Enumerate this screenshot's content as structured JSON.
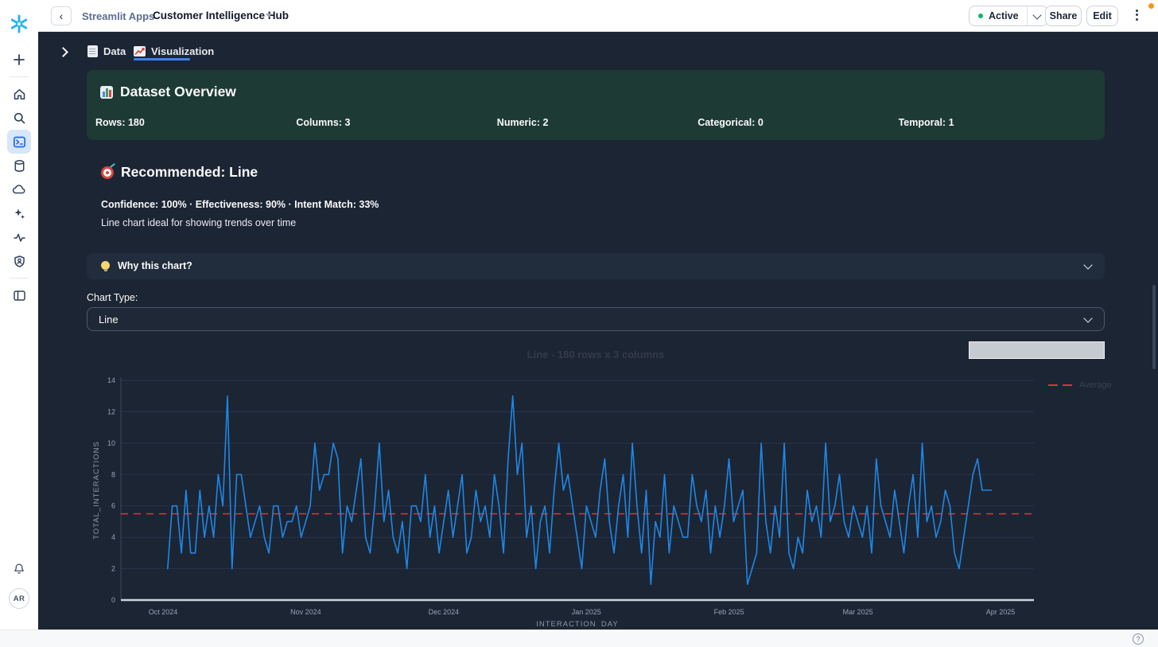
{
  "header": {
    "back_label": "‹",
    "breadcrumb": "Streamlit Apps",
    "app_title": "Customer Intelligence Hub",
    "status_label": "Active",
    "share_label": "Share",
    "edit_label": "Edit"
  },
  "sidebar": {
    "avatar_initials": "AR",
    "icons": [
      "snowflake-logo",
      "plus",
      "home",
      "search",
      "projects",
      "databases",
      "data-products",
      "ai-sparkles",
      "monitoring",
      "admin-shield",
      "panel-toggle",
      "notifications-bell",
      "avatar"
    ]
  },
  "tabs": [
    {
      "label": "Data",
      "active": false
    },
    {
      "label": "Visualization",
      "active": true
    }
  ],
  "dataset_overview": {
    "title": "Dataset Overview",
    "stats": [
      "Rows: 180",
      "Columns: 3",
      "Numeric: 2",
      "Categorical: 0",
      "Temporal: 1"
    ]
  },
  "recommendation": {
    "title": "Recommended: Line",
    "metrics": "Confidence: 100% · Effectiveness: 90% · Intent Match: 33%",
    "description": "Line chart ideal for showing trends over time"
  },
  "expander": {
    "label": "Why this chart?"
  },
  "chart_type": {
    "label": "Chart Type:",
    "value": "Line"
  },
  "footer": {
    "help_glyph": "?"
  },
  "chart_data": {
    "type": "line",
    "title": "Line - 180 rows x 3 columns",
    "xlabel": "INTERACTION_DAY",
    "ylabel": "TOTAL_INTERACTIONS",
    "ylim": [
      0,
      14
    ],
    "yticks": [
      0,
      2,
      4,
      6,
      8,
      10,
      12,
      14
    ],
    "xticks": [
      "Oct 2024",
      "Nov 2024",
      "Dec 2024",
      "Jan 2025",
      "Feb 2025",
      "Mar 2025",
      "Apr 2025"
    ],
    "xtick_days": [
      0,
      31,
      61,
      92,
      123,
      151,
      182
    ],
    "x_start": "2024-10-02",
    "x_frequency": "daily",
    "n_points": 180,
    "line_color": "#1f87e5",
    "average": 5.5,
    "average_color": "#d33a3a",
    "legend_label": "Average",
    "grid": "horizontal",
    "values": [
      2,
      6,
      6,
      3,
      7,
      3,
      3,
      7,
      4,
      6,
      4,
      8,
      6,
      13,
      2,
      8,
      8,
      6,
      4,
      5,
      6,
      4,
      3,
      6,
      6,
      4,
      5,
      5,
      6,
      4,
      5,
      6,
      10,
      7,
      8,
      8,
      10,
      9,
      3,
      6,
      5,
      7,
      9,
      4,
      3,
      6,
      10,
      5,
      7,
      4,
      3,
      5,
      2,
      6,
      6,
      5,
      8,
      4,
      6,
      3,
      5,
      7,
      4,
      6,
      8,
      3,
      4,
      7,
      5,
      6,
      4,
      8,
      6,
      3,
      9,
      13,
      8,
      10,
      4,
      6,
      2,
      5,
      6,
      3,
      7,
      10,
      7,
      8,
      6,
      4,
      2,
      6,
      5,
      4,
      7,
      9,
      5,
      3,
      6,
      8,
      4,
      10,
      6,
      3,
      7,
      1,
      5,
      4,
      8,
      3,
      6,
      5,
      4,
      4,
      8,
      6,
      5,
      7,
      3,
      6,
      4,
      6,
      9,
      5,
      6,
      7,
      1,
      2,
      3,
      10,
      5,
      3,
      6,
      4,
      10,
      3,
      2,
      4,
      3,
      7,
      5,
      6,
      4,
      10,
      5,
      6,
      8,
      5,
      4,
      6,
      5,
      4,
      6,
      3,
      9,
      6,
      5,
      4,
      7,
      5,
      3,
      6,
      8,
      4,
      10,
      5,
      6,
      4,
      5,
      7,
      6,
      3,
      2,
      4,
      6,
      8,
      9,
      7,
      7,
      7
    ]
  }
}
